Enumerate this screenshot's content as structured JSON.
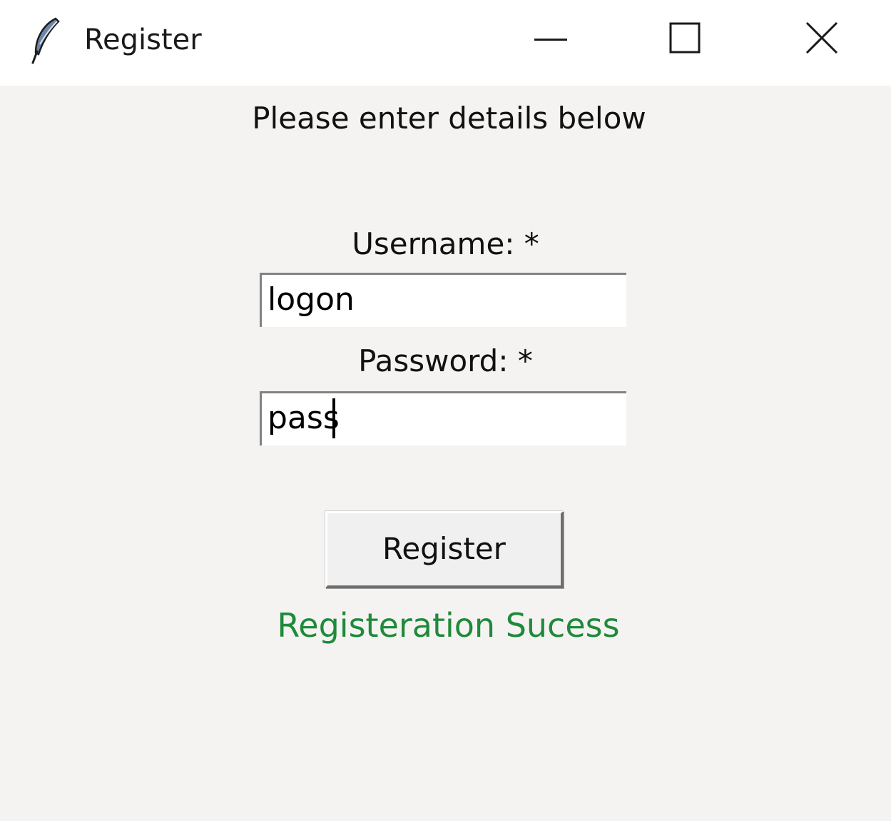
{
  "window": {
    "title": "Register",
    "icon": "feather-icon",
    "controls": {
      "minimize_icon": "minimize-icon",
      "maximize_icon": "maximize-icon",
      "close_icon": "close-icon"
    }
  },
  "form": {
    "heading": "Please enter details below",
    "username_label": "Username: *",
    "username_value": "logon",
    "password_label": "Password: *",
    "password_value": "pass",
    "register_button_label": "Register"
  },
  "status": {
    "message": "Registeration Sucess",
    "color": "#1f8a3a"
  },
  "colors": {
    "background": "#f4f3f2",
    "titlebar": "#ffffff"
  }
}
